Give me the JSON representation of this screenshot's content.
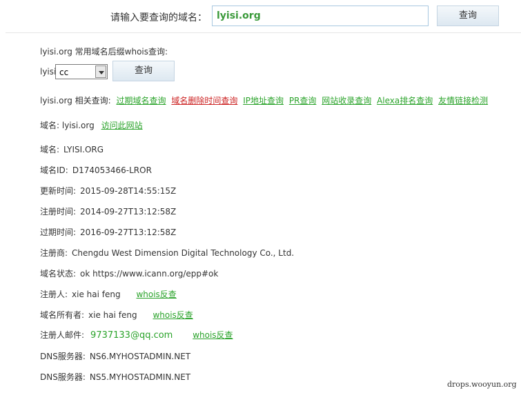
{
  "search": {
    "label": "请输入要查询的域名：",
    "value": "lyisi.org",
    "button": "查询"
  },
  "suffix": {
    "title": "lyisi.org 常用域名后缀whois查询:",
    "prefix": "lyisi.",
    "selected": "cc",
    "button": "查询"
  },
  "related": {
    "label": "lyisi.org 相关查询:",
    "links": [
      "过期域名查询",
      "域名删除时间查询",
      "IP地址查询",
      "PR查询",
      "网站收录查询",
      "Alexa排名查询",
      "友情链接检测"
    ]
  },
  "site": {
    "label": "域名:",
    "domain": "lyisi.org",
    "link": "访问此网站"
  },
  "whois": {
    "domain_label": "域名:",
    "domain": "LYISI.ORG",
    "id_label": "域名ID:",
    "id": "D174053466-LROR",
    "updated_label": "更新时间:",
    "updated": "2015-09-28T14:55:15Z",
    "created_label": "注册时间:",
    "created": "2014-09-27T13:12:58Z",
    "expires_label": "过期时间:",
    "expires": "2016-09-27T13:12:58Z",
    "registrar_label": "注册商:",
    "registrar": "Chengdu West Dimension Digital Technology Co., Ltd.",
    "status_label": "域名状态:",
    "status": "ok https://www.icann.org/epp#ok",
    "registrant_label": "注册人:",
    "registrant": "xie hai feng",
    "registrant_link": "whois反查",
    "owner_label": "域名所有者:",
    "owner": "xie hai feng",
    "owner_link": "whois反查",
    "email_label": "注册人邮件:",
    "email": "9737133@qq.com",
    "email_link": "whois反查",
    "dns1_label": "DNS服务器:",
    "dns1": "NS6.MYHOSTADMIN.NET",
    "dns2_label": "DNS服务器:",
    "dns2": "NS5.MYHOSTADMIN.NET"
  },
  "watermark": "drops.wooyun.org",
  "colors": {
    "link": "#2aa32a",
    "link_active": "#cc2222",
    "input_text": "#3a9a3a"
  }
}
